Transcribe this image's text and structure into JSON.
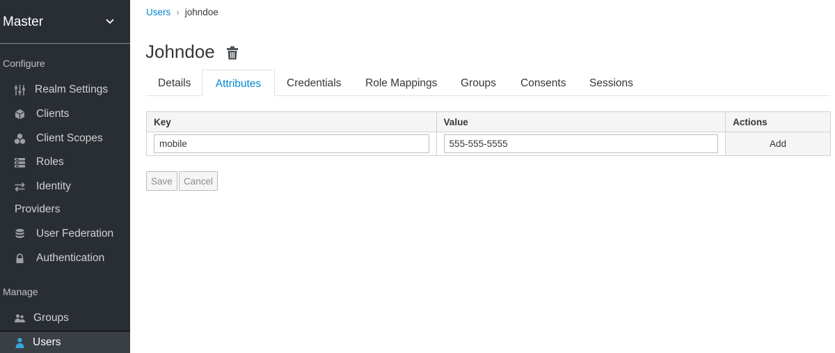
{
  "sidebar": {
    "realm": "Master",
    "sections": {
      "configure": "Configure",
      "manage": "Manage"
    },
    "configure_items": [
      {
        "label": "Realm Settings",
        "icon": "sliders-icon"
      },
      {
        "label": "Clients",
        "icon": "cube-icon"
      },
      {
        "label": "Client Scopes",
        "icon": "cubes-icon"
      },
      {
        "label": "Roles",
        "icon": "roles-icon"
      },
      {
        "label": "Identity",
        "icon": "exchange-icon"
      },
      {
        "label": "Providers",
        "icon": ""
      },
      {
        "label": "User Federation",
        "icon": "database-icon"
      },
      {
        "label": "Authentication",
        "icon": "lock-icon"
      }
    ],
    "manage_items": [
      {
        "label": "Groups",
        "icon": "users-icon"
      },
      {
        "label": "Users",
        "icon": "user-icon",
        "active": true
      }
    ]
  },
  "breadcrumb": {
    "parent": "Users",
    "current": "johndoe"
  },
  "page": {
    "title": "Johndoe"
  },
  "tabs": [
    {
      "label": "Details"
    },
    {
      "label": "Attributes",
      "active": true
    },
    {
      "label": "Credentials"
    },
    {
      "label": "Role Mappings"
    },
    {
      "label": "Groups"
    },
    {
      "label": "Consents"
    },
    {
      "label": "Sessions"
    }
  ],
  "attributes_table": {
    "headers": {
      "key": "Key",
      "value": "Value",
      "actions": "Actions"
    },
    "rows": [
      {
        "key": "mobile",
        "value": "555-555-5555",
        "action": "Add"
      }
    ]
  },
  "buttons": {
    "save": "Save",
    "cancel": "Cancel"
  },
  "colors": {
    "sidebar_bg": "#292e34",
    "active_nav_bg": "#393f44",
    "link": "#0088ce",
    "active_user_icon": "#39a5dc"
  }
}
